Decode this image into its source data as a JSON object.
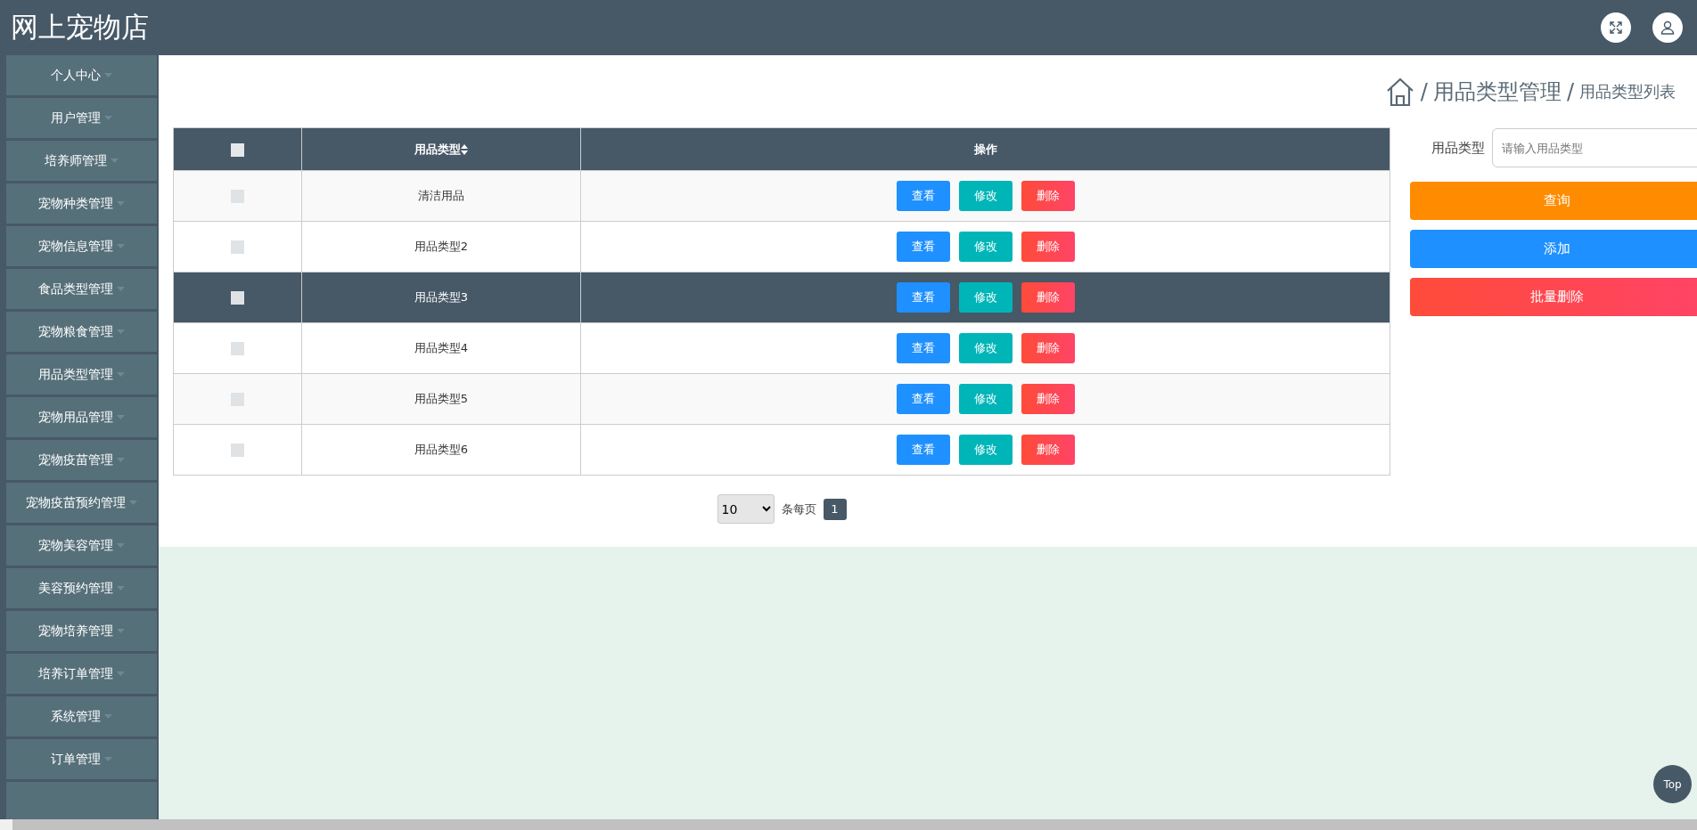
{
  "header": {
    "title": "网上宠物店"
  },
  "sidebar": {
    "items": [
      {
        "label": "个人中心"
      },
      {
        "label": "用户管理"
      },
      {
        "label": "培养师管理"
      },
      {
        "label": "宠物种类管理"
      },
      {
        "label": "宠物信息管理"
      },
      {
        "label": "食品类型管理"
      },
      {
        "label": "宠物粮食管理"
      },
      {
        "label": "用品类型管理"
      },
      {
        "label": "宠物用品管理"
      },
      {
        "label": "宠物疫苗管理"
      },
      {
        "label": "宠物疫苗预约管理"
      },
      {
        "label": "宠物美容管理"
      },
      {
        "label": "美容预约管理"
      },
      {
        "label": "宠物培养管理"
      },
      {
        "label": "培养订单管理"
      },
      {
        "label": "系统管理"
      },
      {
        "label": "订单管理"
      }
    ]
  },
  "breadcrumb": {
    "items": [
      {
        "separator": "/",
        "label": "用品类型管理"
      },
      {
        "separator": "/",
        "label": "用品类型列表"
      }
    ]
  },
  "table": {
    "header_checkbox": {
      "checked": false
    },
    "columns": [
      "用品类型",
      "操作"
    ],
    "rows": [
      {
        "checked": false,
        "hovered": false,
        "name": "清洁用品",
        "actions": [
          {
            "kind": "view",
            "label": "查看"
          },
          {
            "kind": "edit",
            "label": "修改"
          },
          {
            "kind": "delete",
            "label": "删除"
          }
        ]
      },
      {
        "checked": false,
        "hovered": false,
        "name": "用品类型2",
        "actions": [
          {
            "kind": "view",
            "label": "查看"
          },
          {
            "kind": "edit",
            "label": "修改"
          },
          {
            "kind": "delete",
            "label": "删除"
          }
        ]
      },
      {
        "checked": false,
        "hovered": true,
        "name": "用品类型3",
        "actions": [
          {
            "kind": "view",
            "label": "查看"
          },
          {
            "kind": "edit",
            "label": "修改"
          },
          {
            "kind": "delete",
            "label": "删除"
          }
        ]
      },
      {
        "checked": false,
        "hovered": false,
        "name": "用品类型4",
        "actions": [
          {
            "kind": "view",
            "label": "查看"
          },
          {
            "kind": "edit",
            "label": "修改"
          },
          {
            "kind": "delete",
            "label": "删除"
          }
        ]
      },
      {
        "checked": false,
        "hovered": false,
        "name": "用品类型5",
        "actions": [
          {
            "kind": "view",
            "label": "查看"
          },
          {
            "kind": "edit",
            "label": "修改"
          },
          {
            "kind": "delete",
            "label": "删除"
          }
        ]
      },
      {
        "checked": false,
        "hovered": false,
        "name": "用品类型6",
        "actions": [
          {
            "kind": "view",
            "label": "查看"
          },
          {
            "kind": "edit",
            "label": "修改"
          },
          {
            "kind": "delete",
            "label": "删除"
          }
        ]
      }
    ]
  },
  "pagination": {
    "page_size": "10",
    "per_page_label": "条每页",
    "pages": [
      {
        "label": "1",
        "selected": true
      }
    ]
  },
  "search": {
    "label": "用品类型",
    "placeholder": "请输入用品类型"
  },
  "buttons": [
    {
      "kind": "search",
      "label": "查询"
    },
    {
      "kind": "add",
      "label": "添加"
    },
    {
      "kind": "batch-delete",
      "label": "批量删除"
    }
  ],
  "back_to_top": {
    "label": "Top"
  }
}
